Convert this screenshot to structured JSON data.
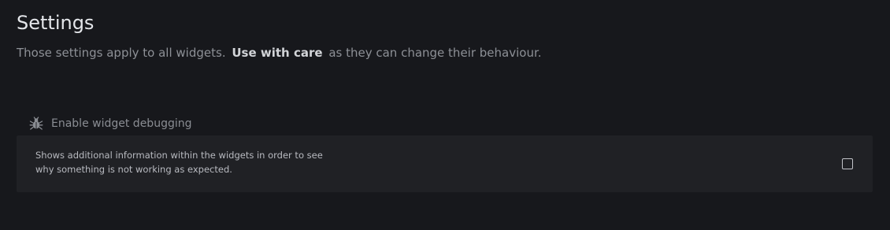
{
  "header": {
    "title": "Settings",
    "subtitle_before": "Those settings apply to all widgets.",
    "subtitle_emphasis": "Use with care",
    "subtitle_after": "as they can change their behaviour."
  },
  "settings": [
    {
      "icon": "bug-icon",
      "label": "Enable widget debugging",
      "description_line1": "Shows additional information within the widgets in order to see",
      "description_line2": "why something is not working as expected.",
      "checked": false
    }
  ]
}
